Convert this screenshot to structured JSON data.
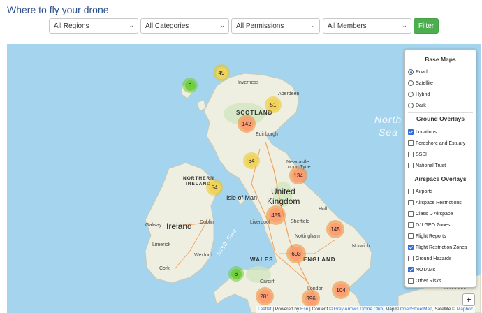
{
  "page": {
    "title": "Where to fly your drone"
  },
  "filters": {
    "regions": "All Regions",
    "categories": "All Categories",
    "permissions": "All Permissions",
    "members": "All Members",
    "button": "Filter",
    "accent": "#4cae4c"
  },
  "map": {
    "labels": {
      "inverness": "Inverness",
      "aberdeen": "Aberdeen",
      "scotland": "SCOTLAND",
      "edinburgh": "Edinburgh",
      "northern_ireland_1": "NORTHERN",
      "northern_ireland_2": "IRELAND",
      "isle_of_man": "Isle of Man",
      "newcastle_1": "Newcastle",
      "newcastle_2": "upon Tyne",
      "united_kingdom_1": "United",
      "united_kingdom_2": "Kingdom",
      "hull": "Hull",
      "liverpool": "Liverpool",
      "sheffield": "Sheffield",
      "nottingham": "Nottingham",
      "norwich": "Norwich",
      "galway": "Galway",
      "dublin": "Dublin",
      "ireland": "Ireland",
      "limerick": "Limerick",
      "wexford": "Wexford",
      "cork": "Cork",
      "wales": "WALES",
      "england": "ENGLAND",
      "cardiff": "Cardiff",
      "london": "London",
      "irish_sea": "Irish Sea",
      "north_sea_1": "North",
      "north_sea_2": "Sea",
      "dusseldorf": "Dusseldorf"
    },
    "clusters": [
      {
        "count": "49",
        "color": "yellow"
      },
      {
        "count": "6",
        "color": "green"
      },
      {
        "count": "51",
        "color": "yellow"
      },
      {
        "count": "142",
        "color": "orange"
      },
      {
        "count": "64",
        "color": "yellow"
      },
      {
        "count": "134",
        "color": "orange"
      },
      {
        "count": "54",
        "color": "yellow"
      },
      {
        "count": "455",
        "color": "orange"
      },
      {
        "count": "145",
        "color": "orange"
      },
      {
        "count": "603",
        "color": "orange"
      },
      {
        "count": "6",
        "color": "green"
      },
      {
        "count": "281",
        "color": "orange"
      },
      {
        "count": "396",
        "color": "orange"
      },
      {
        "count": "104",
        "color": "orange"
      }
    ],
    "zoom_in": "+",
    "attribution": {
      "leaflet": "Leaflet",
      "powered": " | Powered by ",
      "esri": "Esri",
      "content": " | Content © ",
      "gadc": "Grey Arrows Drone Club",
      "mapc": ", Map © ",
      "osm": "OpenStreetMap",
      "satc": ", Satellite © ",
      "mapbox": "Mapbox"
    }
  },
  "layers": {
    "base_heading": "Base Maps",
    "base": [
      {
        "label": "Road",
        "checked": true
      },
      {
        "label": "Satellite",
        "checked": false
      },
      {
        "label": "Hybrid",
        "checked": false
      },
      {
        "label": "Dark",
        "checked": false
      }
    ],
    "ground_heading": "Ground Overlays",
    "ground": [
      {
        "label": "Locations",
        "checked": true
      },
      {
        "label": "Foreshore and Estuary",
        "checked": false
      },
      {
        "label": "SSSI",
        "checked": false
      },
      {
        "label": "National Trust",
        "checked": false
      }
    ],
    "air_heading": "Airspace Overlays",
    "air": [
      {
        "label": "Airports",
        "checked": false
      },
      {
        "label": "Airspace Restrictions",
        "checked": false
      },
      {
        "label": "Class D Airspace",
        "checked": false
      },
      {
        "label": "DJI GEO Zones",
        "checked": false
      },
      {
        "label": "Flight Reports",
        "checked": false
      },
      {
        "label": "Flight Restriction Zones",
        "checked": true
      },
      {
        "label": "Ground Hazards",
        "checked": false
      },
      {
        "label": "NOTAMs",
        "checked": true
      },
      {
        "label": "Other Risks",
        "checked": false
      }
    ]
  }
}
